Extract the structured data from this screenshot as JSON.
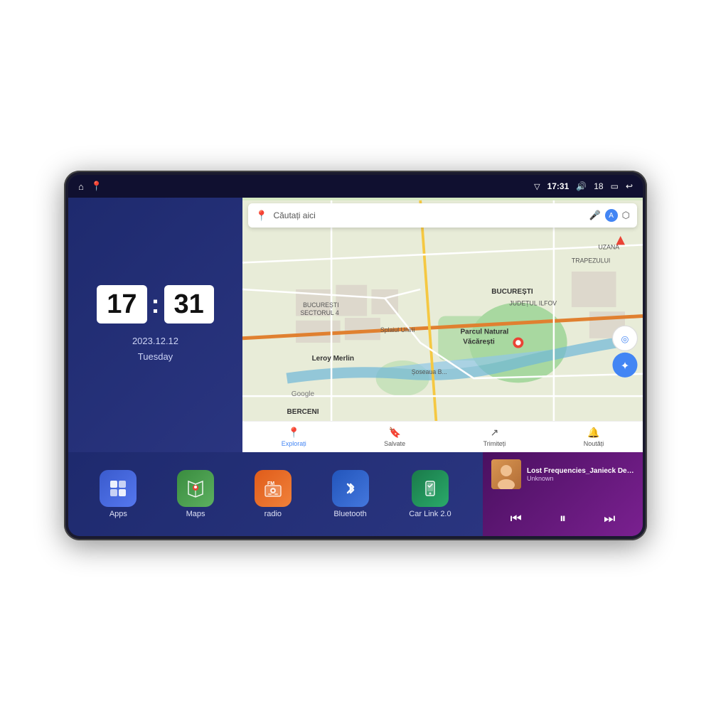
{
  "device": {
    "screen_bg": "#1a1f5e"
  },
  "status_bar": {
    "left_icons": [
      "home",
      "location"
    ],
    "time": "17:31",
    "volume_icon": "🔊",
    "volume_level": "18",
    "battery_icon": "🔋",
    "back_icon": "↩"
  },
  "clock": {
    "hour": "17",
    "minute": "31",
    "date": "2023.12.12",
    "day": "Tuesday"
  },
  "map": {
    "search_placeholder": "Căutați aici",
    "nav_items": [
      {
        "label": "Explorați",
        "active": true
      },
      {
        "label": "Salvate",
        "active": false
      },
      {
        "label": "Trimiteți",
        "active": false
      },
      {
        "label": "Noutăți",
        "active": false
      }
    ],
    "places": [
      "Parcul Natural Văcărești",
      "Leroy Merlin",
      "BUCUREȘTI SECTORUL 4",
      "BUCUREȘTI",
      "JUDEȚUL ILFOV",
      "TRAPEZULUI",
      "BERCENI",
      "UZANA"
    ]
  },
  "apps": [
    {
      "id": "apps",
      "label": "Apps",
      "icon": "⊞"
    },
    {
      "id": "maps",
      "label": "Maps",
      "icon": "📍"
    },
    {
      "id": "radio",
      "label": "radio",
      "icon": "📻"
    },
    {
      "id": "bluetooth",
      "label": "Bluetooth",
      "icon": "🔷"
    },
    {
      "id": "carlink",
      "label": "Car Link 2.0",
      "icon": "📱"
    }
  ],
  "music": {
    "title": "Lost Frequencies_Janieck Devy-...",
    "artist": "Unknown",
    "controls": {
      "prev": "⏮",
      "play": "⏸",
      "next": "⏭"
    }
  }
}
